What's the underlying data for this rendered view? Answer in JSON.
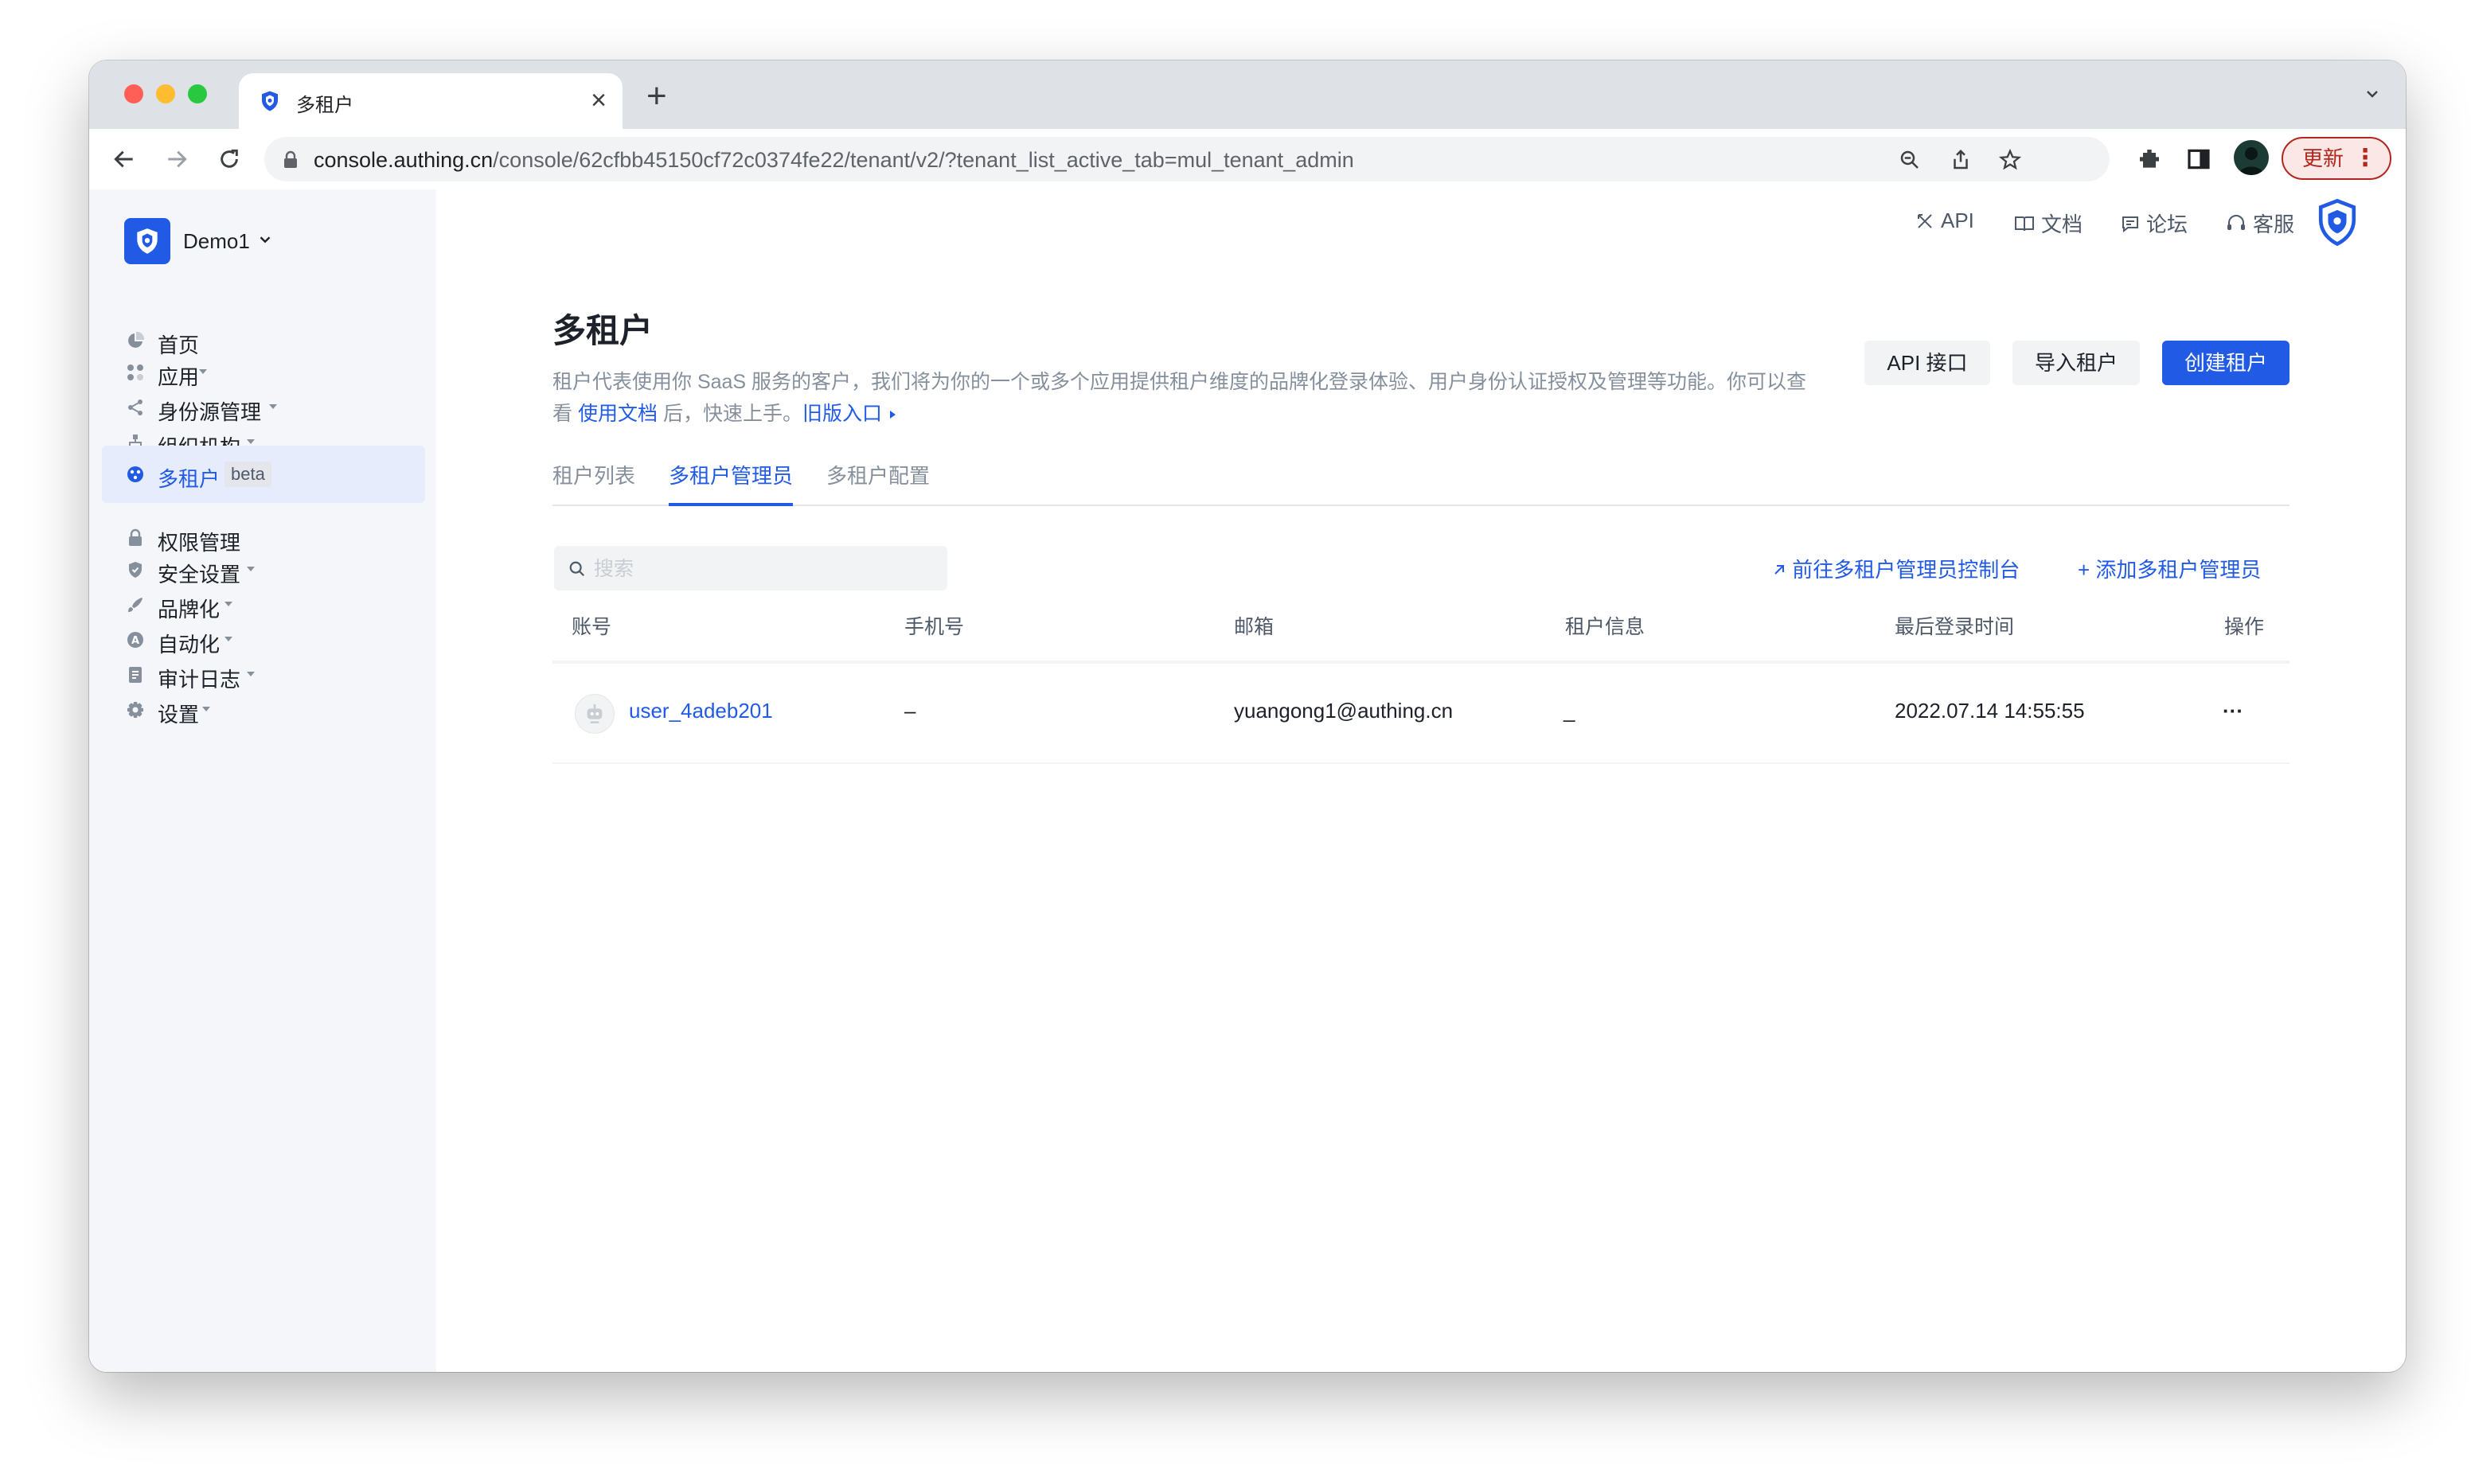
{
  "browser": {
    "tab_title": "多租户",
    "url_host": "console.authing.cn",
    "url_path": "/console/62cfbb45150cf72c0374fe22/tenant/v2/?tenant_list_active_tab=mul_tenant_admin",
    "update_label": "更新"
  },
  "sidebar": {
    "app_name": "Demo1",
    "items": [
      {
        "label": "首页"
      },
      {
        "label": "应用"
      },
      {
        "label": "身份源管理"
      },
      {
        "label": "组织机构"
      },
      {
        "label": "多租户",
        "badge": "beta"
      },
      {
        "label": "权限管理"
      },
      {
        "label": "安全设置"
      },
      {
        "label": "品牌化"
      },
      {
        "label": "自动化"
      },
      {
        "label": "审计日志"
      },
      {
        "label": "设置"
      }
    ]
  },
  "header_links": {
    "api": "API",
    "docs": "文档",
    "forum": "论坛",
    "support": "客服"
  },
  "main": {
    "title": "多租户",
    "desc_1": "租户代表使用你 SaaS 服务的客户，我们将为你的一个或多个应用提供租户维度的品牌化登录体验、用户身份认证授权及管理等功能。你可以查看",
    "desc_link_docs": "使用文档",
    "desc_2": "后，快速上手。",
    "desc_link_legacy": "旧版入口",
    "buttons": {
      "api": "API 接口",
      "import": "导入租户",
      "create": "创建租户"
    },
    "tabs": [
      "租户列表",
      "多租户管理员",
      "多租户配置"
    ],
    "search_placeholder": "搜索",
    "link_console": "前往多租户管理员控制台",
    "link_add": "添加多租户管理员",
    "columns": [
      "账号",
      "手机号",
      "邮箱",
      "租户信息",
      "最后登录时间",
      "操作"
    ],
    "rows": [
      {
        "account": "user_4adeb201",
        "phone": "–",
        "email": "yuangong1@authing.cn",
        "tenant_info": "_",
        "last_login": "2022.07.14 14:55:55",
        "actions": "···"
      }
    ]
  },
  "colors": {
    "primary": "#215ae5",
    "sidebar_bg": "#f5f6f9",
    "active_bg": "#e6ecfc"
  }
}
